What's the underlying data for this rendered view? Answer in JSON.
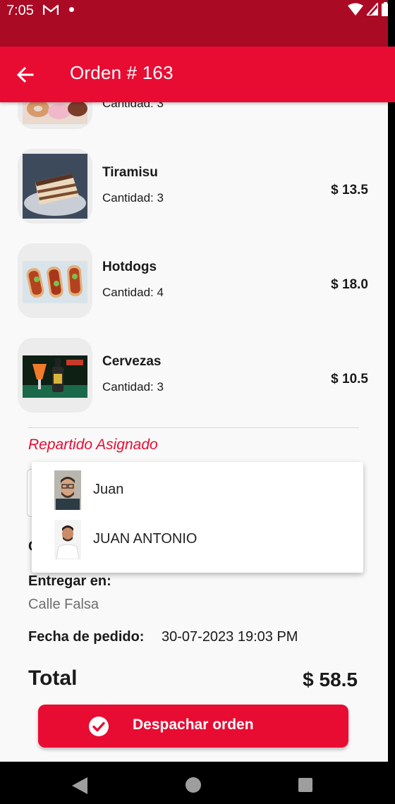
{
  "status_bar": {
    "time": "7:05"
  },
  "app_bar": {
    "title": "Orden # 163"
  },
  "items": [
    {
      "name": "",
      "quantity": "Cantidad: 3",
      "price": ""
    },
    {
      "name": "Tiramisu",
      "quantity": "Cantidad: 3",
      "price": "$ 13.5"
    },
    {
      "name": "Hotdogs",
      "quantity": "Cantidad: 4",
      "price": "$ 18.0"
    },
    {
      "name": "Cervezas",
      "quantity": "Cantidad: 3",
      "price": "$ 10.5"
    }
  ],
  "delivery": {
    "assigned_label": "Repartido Asignado",
    "options": [
      {
        "name": "Juan"
      },
      {
        "name": "JUAN ANTONIO"
      }
    ]
  },
  "order": {
    "hidden_label_fragment": "C",
    "deliver_label": "Entregar en:",
    "deliver_value": "Calle Falsa",
    "date_label": "Fecha de pedido:",
    "date_value": "30-07-2023 19:03 PM",
    "total_label": "Total",
    "total_value": "$ 58.5"
  },
  "actions": {
    "dispatch_label": "Despachar orden"
  },
  "colors": {
    "primary": "#e80c33",
    "status_bar": "#ab0a24",
    "label_gray": "#6e6e6e"
  }
}
